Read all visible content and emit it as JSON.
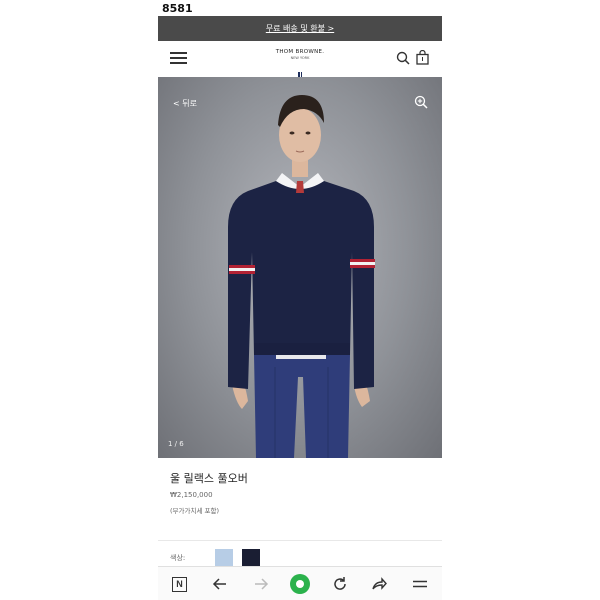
{
  "corner_label": "8581",
  "promo": {
    "text": "무료 배송 및 환불 >"
  },
  "header": {
    "brand": "THOM BROWNE.",
    "brand_city": "NEW YORK",
    "icons": [
      "menu-icon",
      "search-icon",
      "shopping-bag-icon"
    ]
  },
  "hero": {
    "back_label": "<  뒤로",
    "page_indicator": "1 / 6",
    "icons": [
      "zoom-in-icon"
    ]
  },
  "product": {
    "name": "울 릴랙스 풀오버",
    "price": "₩2,150,000",
    "tax_note": "(부가가치세 포함)"
  },
  "colors": {
    "label": "색상:",
    "swatches": [
      {
        "name": "light-blue",
        "hex": "#b7cde6"
      },
      {
        "name": "navy",
        "hex": "#1a1e33"
      }
    ]
  },
  "browser_nav": {
    "n_label": "N",
    "icons": [
      "naver-icon",
      "back-arrow-icon",
      "forward-arrow-icon",
      "home-green-icon",
      "refresh-icon",
      "share-icon",
      "menu-lines-icon"
    ]
  },
  "theme": {
    "promo_bg": "#4a4a4a",
    "brand_stripe": [
      "#1d2d5c",
      "#ffffff",
      "#b22234"
    ],
    "home_green": "#2bb24c"
  }
}
